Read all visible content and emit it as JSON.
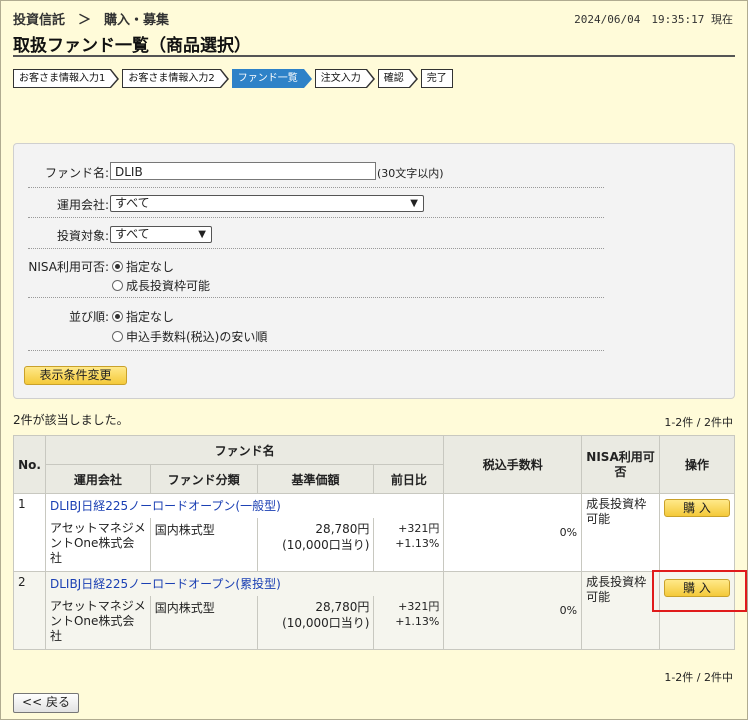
{
  "header": {
    "breadcrumb": "投資信託　＞　購入・募集",
    "timestamp": "2024/06/04　19:35:17 現在",
    "title": "取扱ファンド一覧（商品選択）"
  },
  "steps": [
    "お客さま情報入力1",
    "お客さま情報入力2",
    "ファンド一覧",
    "注文入力",
    "確認",
    "完了"
  ],
  "search": {
    "fund_name_label": "ファンド名:",
    "fund_name_value": "DLIB",
    "fund_name_hint": "(30文字以内)",
    "company_label": "運用会社:",
    "company_value": "すべて",
    "target_label": "投資対象:",
    "target_value": "すべて",
    "nisa_label": "NISA利用可否:",
    "nisa_options": [
      "指定なし",
      "成長投資枠可能"
    ],
    "sort_label": "並び順:",
    "sort_options": [
      "指定なし",
      "申込手数料(税込)の安い順"
    ],
    "apply_button": "表示条件変更"
  },
  "results": {
    "count_text": "2件が該当しました。",
    "pager_text": "1-2件 / 2件中",
    "headers": {
      "no": "No.",
      "fund_name": "ファンド名",
      "company": "運用会社",
      "category": "ファンド分類",
      "nav": "基準価額",
      "change": "前日比",
      "fee": "税込手数料",
      "nisa": "NISA利用可否",
      "action": "操作"
    },
    "rows": [
      {
        "no": "1",
        "name": "DLIBJ日経225ノーロードオープン(一般型)",
        "company": "アセットマネジメントOne株式会社",
        "category": "国内株式型",
        "nav": "28,780円",
        "nav_unit": "(10,000口当り)",
        "change": "+321円",
        "change_pct": "+1.13%",
        "fee": "0%",
        "nisa": "成長投資枠可能",
        "action": "購 入"
      },
      {
        "no": "2",
        "name": "DLIBJ日経225ノーロードオープン(累投型)",
        "company": "アセットマネジメントOne株式会社",
        "category": "国内株式型",
        "nav": "28,780円",
        "nav_unit": "(10,000口当り)",
        "change": "+321円",
        "change_pct": "+1.13%",
        "fee": "0%",
        "nisa": "成長投資枠可能",
        "action": "購 入"
      }
    ]
  },
  "footer": {
    "back_button": "<< 戻る"
  },
  "colors": {
    "background": "#fffbd9",
    "active_step": "#2e82c8",
    "button_yellow": "#f4c93a",
    "link": "#1a3fb3",
    "highlight": "#e01b1b"
  }
}
